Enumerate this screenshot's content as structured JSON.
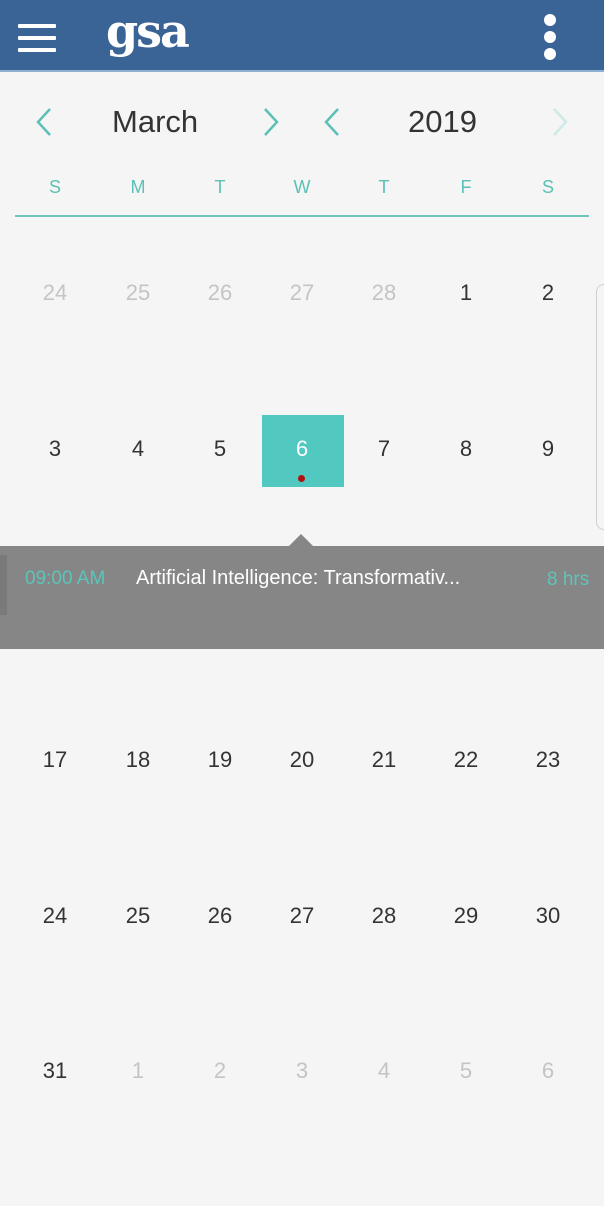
{
  "header": {
    "logo": "gsa",
    "menu_icon": "hamburger-icon",
    "more_icon": "kebab-icon"
  },
  "navigator": {
    "month": "March",
    "year": "2019"
  },
  "weekdays": [
    "S",
    "M",
    "T",
    "W",
    "T",
    "F",
    "S"
  ],
  "weeks": [
    {
      "days": [
        {
          "d": "24",
          "other": true
        },
        {
          "d": "25",
          "other": true
        },
        {
          "d": "26",
          "other": true
        },
        {
          "d": "27",
          "other": true
        },
        {
          "d": "28",
          "other": true
        },
        {
          "d": "1"
        },
        {
          "d": "2"
        }
      ]
    },
    {
      "days": [
        {
          "d": "3"
        },
        {
          "d": "4"
        },
        {
          "d": "5"
        },
        {
          "d": "6",
          "selected": true,
          "has_event": true
        },
        {
          "d": "7"
        },
        {
          "d": "8"
        },
        {
          "d": "9"
        }
      ]
    },
    {
      "days": [
        {
          "d": "17"
        },
        {
          "d": "18"
        },
        {
          "d": "19"
        },
        {
          "d": "20"
        },
        {
          "d": "21"
        },
        {
          "d": "22"
        },
        {
          "d": "23"
        }
      ]
    },
    {
      "days": [
        {
          "d": "24"
        },
        {
          "d": "25"
        },
        {
          "d": "26"
        },
        {
          "d": "27"
        },
        {
          "d": "28"
        },
        {
          "d": "29"
        },
        {
          "d": "30"
        }
      ]
    },
    {
      "days": [
        {
          "d": "31"
        },
        {
          "d": "1",
          "other": true
        },
        {
          "d": "2",
          "other": true
        },
        {
          "d": "3",
          "other": true
        },
        {
          "d": "4",
          "other": true
        },
        {
          "d": "5",
          "other": true
        },
        {
          "d": "6",
          "other": true
        }
      ]
    }
  ],
  "event": {
    "time": "09:00 AM",
    "title": "Artificial Intelligence: Transformativ...",
    "duration": "8 hrs"
  },
  "colors": {
    "header": "#3a6496",
    "accent": "#52c9c0",
    "event_panel": "#868686",
    "event_dot": "#b01010"
  }
}
